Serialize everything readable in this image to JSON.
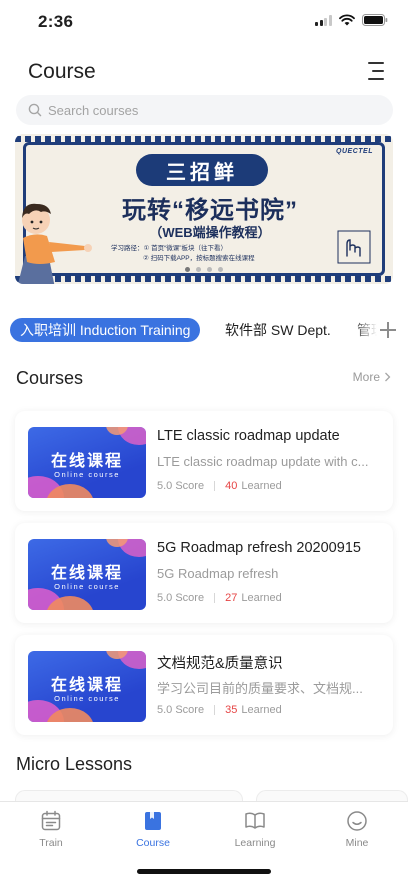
{
  "status_bar": {
    "time": "2:36"
  },
  "header": {
    "title": "Course"
  },
  "search": {
    "placeholder": "Search courses"
  },
  "banner": {
    "tag": "三招鲜",
    "brand": "QUECTEL",
    "title": "玩转“移远书院”",
    "subtitle": "（WEB端操作教程）",
    "note_line1": "学习路径：① 首页“微课”板块（往下看）",
    "note_line2": "② 扫码下载APP，按标题搜索在线课程"
  },
  "category_tabs": [
    {
      "label": "入职培训 Induction Training",
      "active": true
    },
    {
      "label": "软件部 SW Dept.",
      "active": false
    },
    {
      "label": "管理",
      "active": false
    }
  ],
  "courses_section": {
    "title": "Courses",
    "more_label": "More"
  },
  "courses": [
    {
      "thumb_title": "在线课程",
      "thumb_sub": "Online course",
      "name": "LTE classic roadmap update",
      "desc": "LTE classic roadmap update with c...",
      "score": "5.0 Score",
      "learned_count": "40",
      "learned_label": "Learned"
    },
    {
      "thumb_title": "在线课程",
      "thumb_sub": "Online course",
      "name": "5G Roadmap refresh 20200915",
      "desc": "5G Roadmap refresh",
      "score": "5.0 Score",
      "learned_count": "27",
      "learned_label": "Learned"
    },
    {
      "thumb_title": "在线课程",
      "thumb_sub": "Online course",
      "name": "文档规范&质量意识",
      "desc": "学习公司目前的质量要求、文档规...",
      "score": "5.0 Score",
      "learned_count": "35",
      "learned_label": "Learned"
    }
  ],
  "micro_section": {
    "title": "Micro Lessons"
  },
  "tab_bar": [
    {
      "label": "Train",
      "icon": "calendar-icon",
      "active": false
    },
    {
      "label": "Course",
      "icon": "book-icon",
      "active": true
    },
    {
      "label": "Learning",
      "icon": "open-book-icon",
      "active": false
    },
    {
      "label": "Mine",
      "icon": "smile-icon",
      "active": false
    }
  ],
  "colors": {
    "accent": "#3a73e0",
    "learned": "#e64545",
    "banner_navy": "#1c3b78"
  }
}
